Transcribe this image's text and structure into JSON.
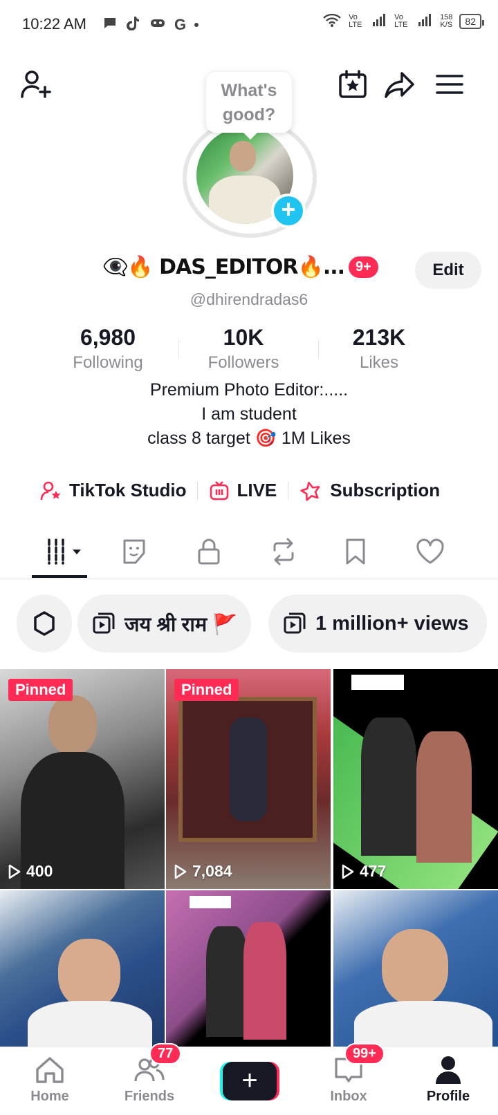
{
  "status_bar": {
    "time": "10:22 AM",
    "speed": "158",
    "speed_unit": "K/S",
    "battery": "82",
    "net1": "Vo LTE",
    "net2": "Vo LTE"
  },
  "header": {
    "story_prompt": "What's good?",
    "icons": [
      "add-friend-icon",
      "calendar-star-icon",
      "share-icon",
      "menu-icon"
    ]
  },
  "profile": {
    "display_name": "👁‍🗨🔥 DAS_EDITOR🔥...",
    "notif_badge": "9+",
    "edit_label": "Edit",
    "handle": "@dhirendradas6",
    "stats": [
      {
        "value": "6,980",
        "label": "Following"
      },
      {
        "value": "10K",
        "label": "Followers"
      },
      {
        "value": "213K",
        "label": "Likes"
      }
    ],
    "bio": [
      "Premium Photo Editor:.....",
      "I am student",
      "class 8 target 🎯 1M Likes"
    ],
    "links": [
      "TikTok Studio",
      "LIVE",
      "Subscription"
    ]
  },
  "tabs": [
    "videos",
    "reposts-sticker",
    "private",
    "reposts",
    "favorites",
    "liked"
  ],
  "chips": [
    "जय श्री राम 🚩",
    "1 million+ views"
  ],
  "videos": [
    {
      "pinned": "Pinned",
      "views": "400"
    },
    {
      "pinned": "Pinned",
      "views": "7,084"
    },
    {
      "pinned": "",
      "views": "477"
    },
    {
      "pinned": "",
      "views": ""
    },
    {
      "pinned": "",
      "views": ""
    },
    {
      "pinned": "",
      "views": ""
    }
  ],
  "nav": {
    "home": "Home",
    "friends": "Friends",
    "friends_count": "77",
    "create": "+",
    "inbox": "Inbox",
    "inbox_count": "99+",
    "profile": "Profile"
  },
  "colors": {
    "accent": "#fe2c55",
    "cyan": "#25f4ee",
    "blue_plus": "#20c4f0"
  }
}
